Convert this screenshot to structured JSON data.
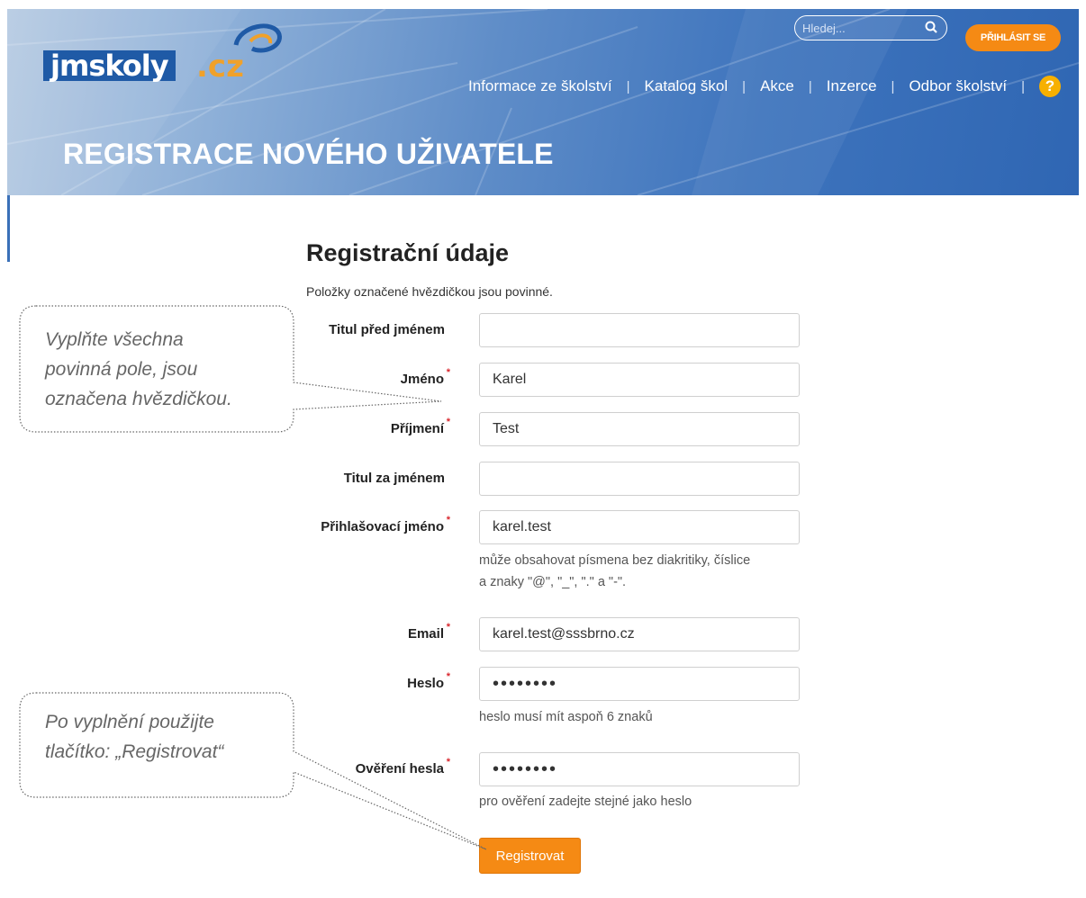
{
  "header": {
    "logo_main": "jmskoly",
    "logo_tld": ".cz",
    "search_placeholder": "Hledej...",
    "login_label": "PŘIHLÁSIT SE",
    "nav": [
      {
        "label": "Informace ze školství"
      },
      {
        "label": "Katalog škol"
      },
      {
        "label": "Akce"
      },
      {
        "label": "Inzerce"
      },
      {
        "label": "Odbor školství"
      }
    ],
    "help_glyph": "?",
    "page_title": "REGISTRACE NOVÉHO UŽIVATELE"
  },
  "form": {
    "heading": "Registrační údaje",
    "note": "Položky označené hvězdičkou jsou povinné.",
    "required_mark": "*",
    "fields": {
      "title_before": {
        "label": "Titul před jménem",
        "value": ""
      },
      "first_name": {
        "label": "Jméno",
        "value": "Karel"
      },
      "last_name": {
        "label": "Příjmení",
        "value": "Test"
      },
      "title_after": {
        "label": "Titul za jménem",
        "value": ""
      },
      "login": {
        "label": "Přihlašovací jméno",
        "value": "karel.test"
      },
      "email": {
        "label": "Email",
        "value": "karel.test@sssbrno.cz"
      },
      "password": {
        "label": "Heslo",
        "value": "••••••••"
      },
      "password_confirm": {
        "label": "Ověření hesla",
        "value": "••••••••"
      }
    },
    "login_hint_line1": "může obsahovat písmena bez diakritiky, číslice",
    "login_hint_line2": "a znaky \"@\", \"_\", \".\" a \"-\".",
    "password_hint": "heslo musí mít aspoň 6 znaků",
    "password_confirm_hint": "pro ověření zadejte stejné jako heslo",
    "submit_label": "Registrovat"
  },
  "callouts": {
    "top_line1": "Vyplňte všechna",
    "top_line2": "povinná pole, jsou",
    "top_line3": "označena hvězdičkou.",
    "bottom_line1": "Po vyplnění použijte",
    "bottom_line2": "tlačítko: „Registrovat“"
  },
  "colors": {
    "accent_orange": "#f58a14",
    "banner_blue": "#2f66b3",
    "required_red": "#d9272e"
  }
}
